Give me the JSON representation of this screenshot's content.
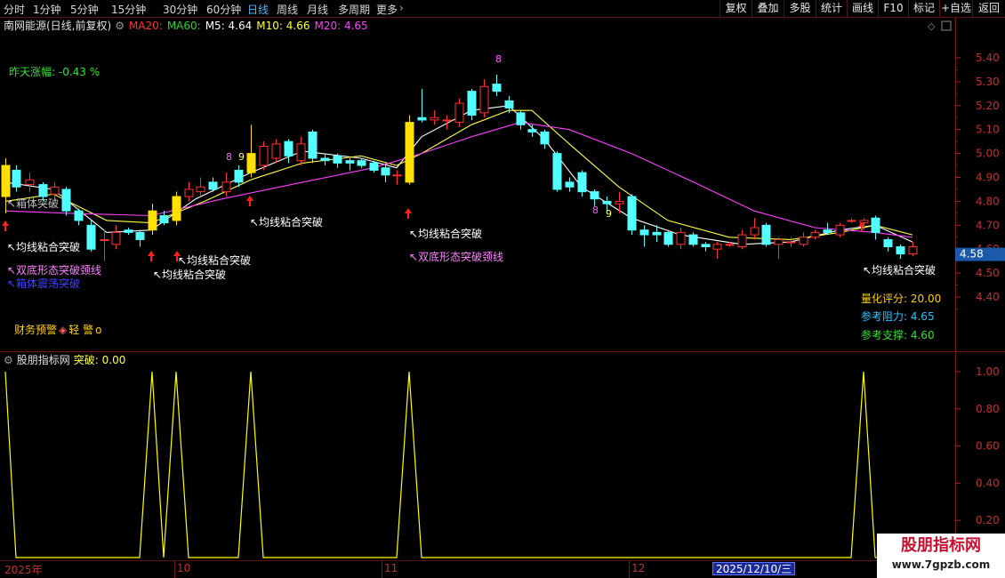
{
  "toolbar": {
    "left": [
      "分时",
      "1分钟",
      "5分钟",
      "15分钟",
      "30分钟",
      "60分钟",
      "日线",
      "周线",
      "月线",
      "多周期",
      "更多"
    ],
    "active": 6,
    "right": [
      "复权",
      "叠加",
      "多股",
      "统计",
      "画线",
      "F10",
      "标记",
      "+自选",
      "返回"
    ]
  },
  "header": {
    "stock": "南网能源(日线,前复权)",
    "ma": [
      {
        "label": "MA20:",
        "value": "",
        "color": "#ff3030"
      },
      {
        "label": "MA60:",
        "value": "",
        "color": "#30d030"
      },
      {
        "label": "M5:",
        "value": "4.64",
        "color": "#ffffff"
      },
      {
        "label": "M10:",
        "value": "4.66",
        "color": "#ffff40"
      },
      {
        "label": "M20:",
        "value": "4.65",
        "color": "#ff40ff"
      }
    ]
  },
  "left_panel": {
    "zhang_fu": "昨天涨幅: -0.43 %",
    "warning": "财务预警",
    "warning_level": "轻 警",
    "warning_mark": "o"
  },
  "right_panel": {
    "score": "量化评分: 20.00",
    "resistance": "参考阻力: 4.65",
    "support": "参考支撑: 4.60",
    "last_price": "4.58"
  },
  "colors": {
    "up": "#ff3232",
    "down": "#54ffff",
    "m5": "#ffffff",
    "m10": "#ffff40",
    "m20": "#ff40ff",
    "arrow": "#ff2020",
    "signal": "#ffff00"
  },
  "annotations": {
    "arrows": [
      6,
      170,
      199,
      281,
      459,
      969
    ],
    "labels": [
      {
        "text": "↖均线粘合突破",
        "x": 8,
        "y": 278,
        "color": "#ffffff"
      },
      {
        "text": "↖双底形态突破颈线",
        "x": 8,
        "y": 304,
        "color": "#ff80ff"
      },
      {
        "text": "↖箱体突破",
        "x": 8,
        "y": 229,
        "color": "#c0c0c0"
      },
      {
        "text": "↖箱体震荡突破",
        "x": 8,
        "y": 319,
        "color": "#4040ff"
      },
      {
        "text": "↖均线粘合突破",
        "x": 172,
        "y": 309,
        "color": "#ffffff"
      },
      {
        "text": "↖均线粘合突破",
        "x": 200,
        "y": 293,
        "color": "#ffffff"
      },
      {
        "text": "↖均线粘合突破",
        "x": 281,
        "y": 250,
        "color": "#ffffff"
      },
      {
        "text": "↖均线粘合突破",
        "x": 460,
        "y": 263,
        "color": "#ffffff"
      },
      {
        "text": "↖双底形态突破颈线",
        "x": 460,
        "y": 289,
        "color": "#ff80ff"
      },
      {
        "text": "↖均线粘合突破",
        "x": 970,
        "y": 304,
        "color": "#ffffff"
      }
    ],
    "counts": [
      {
        "text": "8",
        "x": 254,
        "y": 176,
        "color": "#ff60ff"
      },
      {
        "text": "9",
        "x": 268,
        "y": 176,
        "color": "#ffff60"
      },
      {
        "text": "8",
        "x": 557,
        "y": 66,
        "color": "#ff60ff"
      },
      {
        "text": "8",
        "x": 666,
        "y": 236,
        "color": "#ff60ff"
      },
      {
        "text": "9",
        "x": 681,
        "y": 240,
        "color": "#ffff60"
      }
    ]
  },
  "sub_panel": {
    "title": "股朋指标网",
    "signal_label": "突破:",
    "signal_value": "0.00",
    "peaks": [
      6,
      170,
      199,
      282,
      460,
      969
    ]
  },
  "xaxis": {
    "labels": [
      {
        "text": "2025年",
        "x": 5
      },
      {
        "text": "10",
        "x": 199
      },
      {
        "text": "11",
        "x": 432
      },
      {
        "text": "12",
        "x": 710
      }
    ],
    "cursor_date": "2025/12/10/三"
  },
  "watermark": {
    "title": "股朋指标网",
    "url": "www.7gpzb.com"
  },
  "chart_data": [
    {
      "type": "candlestick",
      "title": "南网能源(日线,前复权)",
      "y_axis_ticks": [
        4.4,
        4.5,
        4.6,
        4.7,
        4.8,
        4.9,
        5.0,
        5.1,
        5.2,
        5.3,
        5.4
      ],
      "ylim": [
        4.33,
        5.49
      ],
      "candles": [
        {
          "x": 6,
          "o": 4.82,
          "c": 4.95,
          "h": 4.98,
          "l": 4.75
        },
        {
          "x": 18,
          "o": 4.93,
          "c": 4.86,
          "h": 4.95,
          "l": 4.84
        },
        {
          "x": 33,
          "o": 4.87,
          "c": 4.89,
          "h": 4.92,
          "l": 4.84
        },
        {
          "x": 48,
          "o": 4.87,
          "c": 4.82,
          "h": 4.88,
          "l": 4.8
        },
        {
          "x": 61,
          "o": 4.83,
          "c": 4.86,
          "h": 4.88,
          "l": 4.8
        },
        {
          "x": 74,
          "o": 4.85,
          "c": 4.76,
          "h": 4.86,
          "l": 4.74
        },
        {
          "x": 88,
          "o": 4.76,
          "c": 4.72,
          "h": 4.77,
          "l": 4.7
        },
        {
          "x": 102,
          "o": 4.7,
          "c": 4.6,
          "h": 4.72,
          "l": 4.59
        },
        {
          "x": 117,
          "o": 4.64,
          "c": 4.64,
          "h": 4.68,
          "l": 4.55
        },
        {
          "x": 130,
          "o": 4.62,
          "c": 4.67,
          "h": 4.7,
          "l": 4.6
        },
        {
          "x": 144,
          "o": 4.68,
          "c": 4.67,
          "h": 4.69,
          "l": 4.66
        },
        {
          "x": 157,
          "o": 4.67,
          "c": 4.64,
          "h": 4.68,
          "l": 4.61
        },
        {
          "x": 171,
          "o": 4.68,
          "c": 4.76,
          "h": 4.79,
          "l": 4.66
        },
        {
          "x": 184,
          "o": 4.74,
          "c": 4.71,
          "h": 4.76,
          "l": 4.7
        },
        {
          "x": 198,
          "o": 4.72,
          "c": 4.82,
          "h": 4.84,
          "l": 4.7
        },
        {
          "x": 212,
          "o": 4.82,
          "c": 4.85,
          "h": 4.88,
          "l": 4.8
        },
        {
          "x": 225,
          "o": 4.84,
          "c": 4.86,
          "h": 4.9,
          "l": 4.82
        },
        {
          "x": 239,
          "o": 4.88,
          "c": 4.85,
          "h": 4.9,
          "l": 4.84
        },
        {
          "x": 254,
          "o": 4.84,
          "c": 4.88,
          "h": 4.92,
          "l": 4.82
        },
        {
          "x": 268,
          "o": 4.93,
          "c": 4.88,
          "h": 4.95,
          "l": 4.86
        },
        {
          "x": 282,
          "o": 4.92,
          "c": 5.0,
          "h": 5.12,
          "l": 4.9
        },
        {
          "x": 296,
          "o": 4.95,
          "c": 5.03,
          "h": 5.05,
          "l": 4.93
        },
        {
          "x": 310,
          "o": 4.98,
          "c": 5.04,
          "h": 5.06,
          "l": 4.96
        },
        {
          "x": 324,
          "o": 5.05,
          "c": 4.99,
          "h": 5.06,
          "l": 4.96
        },
        {
          "x": 338,
          "o": 4.97,
          "c": 5.04,
          "h": 5.07,
          "l": 4.95
        },
        {
          "x": 351,
          "o": 5.09,
          "c": 4.98,
          "h": 5.1,
          "l": 4.96
        },
        {
          "x": 365,
          "o": 4.98,
          "c": 4.97,
          "h": 5.0,
          "l": 4.95
        },
        {
          "x": 379,
          "o": 4.99,
          "c": 4.96,
          "h": 5.0,
          "l": 4.94
        },
        {
          "x": 393,
          "o": 4.97,
          "c": 4.96,
          "h": 4.98,
          "l": 4.93
        },
        {
          "x": 406,
          "o": 4.97,
          "c": 4.95,
          "h": 4.98,
          "l": 4.94
        },
        {
          "x": 420,
          "o": 4.96,
          "c": 4.93,
          "h": 4.97,
          "l": 4.92
        },
        {
          "x": 433,
          "o": 4.94,
          "c": 4.91,
          "h": 4.96,
          "l": 4.88
        },
        {
          "x": 446,
          "o": 4.91,
          "c": 4.91,
          "h": 4.93,
          "l": 4.87
        },
        {
          "x": 460,
          "o": 4.88,
          "c": 5.13,
          "h": 5.16,
          "l": 4.87
        },
        {
          "x": 474,
          "o": 5.15,
          "c": 5.14,
          "h": 5.27,
          "l": 5.13
        },
        {
          "x": 488,
          "o": 5.14,
          "c": 5.15,
          "h": 5.18,
          "l": 5.12
        },
        {
          "x": 502,
          "o": 5.14,
          "c": 5.14,
          "h": 5.16,
          "l": 5.1
        },
        {
          "x": 516,
          "o": 5.13,
          "c": 5.21,
          "h": 5.23,
          "l": 5.11
        },
        {
          "x": 530,
          "o": 5.26,
          "c": 5.16,
          "h": 5.27,
          "l": 5.14
        },
        {
          "x": 544,
          "o": 5.17,
          "c": 5.28,
          "h": 5.31,
          "l": 5.15
        },
        {
          "x": 558,
          "o": 5.29,
          "c": 5.26,
          "h": 5.33,
          "l": 5.24
        },
        {
          "x": 572,
          "o": 5.22,
          "c": 5.19,
          "h": 5.24,
          "l": 5.17
        },
        {
          "x": 585,
          "o": 5.17,
          "c": 5.12,
          "h": 5.18,
          "l": 5.1
        },
        {
          "x": 598,
          "o": 5.1,
          "c": 5.09,
          "h": 5.12,
          "l": 5.07
        },
        {
          "x": 612,
          "o": 5.09,
          "c": 5.04,
          "h": 5.1,
          "l": 5.02
        },
        {
          "x": 626,
          "o": 5.0,
          "c": 4.85,
          "h": 5.01,
          "l": 4.84
        },
        {
          "x": 640,
          "o": 4.88,
          "c": 4.86,
          "h": 4.9,
          "l": 4.84
        },
        {
          "x": 654,
          "o": 4.92,
          "c": 4.84,
          "h": 4.93,
          "l": 4.82
        },
        {
          "x": 668,
          "o": 4.84,
          "c": 4.81,
          "h": 4.85,
          "l": 4.78
        },
        {
          "x": 682,
          "o": 4.8,
          "c": 4.79,
          "h": 4.82,
          "l": 4.76
        },
        {
          "x": 696,
          "o": 4.79,
          "c": 4.8,
          "h": 4.84,
          "l": 4.75
        },
        {
          "x": 710,
          "o": 4.82,
          "c": 4.68,
          "h": 4.83,
          "l": 4.66
        },
        {
          "x": 724,
          "o": 4.68,
          "c": 4.66,
          "h": 4.7,
          "l": 4.61
        },
        {
          "x": 738,
          "o": 4.67,
          "c": 4.66,
          "h": 4.7,
          "l": 4.63
        },
        {
          "x": 751,
          "o": 4.67,
          "c": 4.62,
          "h": 4.68,
          "l": 4.61
        },
        {
          "x": 765,
          "o": 4.62,
          "c": 4.67,
          "h": 4.69,
          "l": 4.6
        },
        {
          "x": 779,
          "o": 4.66,
          "c": 4.62,
          "h": 4.67,
          "l": 4.61
        },
        {
          "x": 793,
          "o": 4.62,
          "c": 4.61,
          "h": 4.63,
          "l": 4.59
        },
        {
          "x": 806,
          "o": 4.6,
          "c": 4.62,
          "h": 4.63,
          "l": 4.56
        },
        {
          "x": 820,
          "o": 4.62,
          "c": 4.62,
          "h": 4.63,
          "l": 4.61
        },
        {
          "x": 834,
          "o": 4.61,
          "c": 4.66,
          "h": 4.68,
          "l": 4.6
        },
        {
          "x": 848,
          "o": 4.66,
          "c": 4.69,
          "h": 4.73,
          "l": 4.64
        },
        {
          "x": 861,
          "o": 4.7,
          "c": 4.62,
          "h": 4.71,
          "l": 4.61
        },
        {
          "x": 875,
          "o": 4.62,
          "c": 4.64,
          "h": 4.65,
          "l": 4.56
        },
        {
          "x": 889,
          "o": 4.63,
          "c": 4.63,
          "h": 4.65,
          "l": 4.61
        },
        {
          "x": 903,
          "o": 4.62,
          "c": 4.65,
          "h": 4.67,
          "l": 4.61
        },
        {
          "x": 916,
          "o": 4.65,
          "c": 4.67,
          "h": 4.68,
          "l": 4.64
        },
        {
          "x": 930,
          "o": 4.68,
          "c": 4.67,
          "h": 4.71,
          "l": 4.66
        },
        {
          "x": 944,
          "o": 4.66,
          "c": 4.7,
          "h": 4.71,
          "l": 4.65
        },
        {
          "x": 957,
          "o": 4.72,
          "c": 4.72,
          "h": 4.73,
          "l": 4.71
        },
        {
          "x": 971,
          "o": 4.71,
          "c": 4.72,
          "h": 4.73,
          "l": 4.68
        },
        {
          "x": 984,
          "o": 4.73,
          "c": 4.67,
          "h": 4.74,
          "l": 4.64
        },
        {
          "x": 998,
          "o": 4.64,
          "c": 4.61,
          "h": 4.65,
          "l": 4.59
        },
        {
          "x": 1012,
          "o": 4.61,
          "c": 4.58,
          "h": 4.62,
          "l": 4.56
        },
        {
          "x": 1026,
          "o": 4.58,
          "c": 4.61,
          "h": 4.63,
          "l": 4.57
        }
      ],
      "series": [
        {
          "name": "M5",
          "x": [
            6,
            60,
            120,
            170,
            220,
            282,
            340,
            406,
            446,
            474,
            530,
            572,
            612,
            654,
            710,
            765,
            834,
            889,
            944,
            984,
            1026
          ],
          "values": [
            4.88,
            4.85,
            4.67,
            4.68,
            4.81,
            4.92,
            5.01,
            4.98,
            4.94,
            5.07,
            5.18,
            5.2,
            5.06,
            4.86,
            4.73,
            4.66,
            4.62,
            4.63,
            4.68,
            4.7,
            4.63
          ]
        },
        {
          "name": "M10",
          "x": [
            6,
            60,
            120,
            170,
            230,
            282,
            340,
            406,
            446,
            474,
            530,
            572,
            598,
            640,
            696,
            751,
            820,
            889,
            944,
            984,
            1026
          ],
          "values": [
            4.8,
            4.83,
            4.72,
            4.71,
            4.8,
            4.89,
            4.96,
            4.99,
            4.95,
            5.0,
            5.12,
            5.18,
            5.18,
            5.04,
            4.86,
            4.72,
            4.65,
            4.64,
            4.67,
            4.7,
            4.66
          ]
        },
        {
          "name": "M20",
          "x": [
            6,
            80,
            170,
            250,
            340,
            420,
            474,
            530,
            585,
            640,
            710,
            780,
            848,
            916,
            984,
            1026
          ],
          "values": [
            4.76,
            4.75,
            4.74,
            4.81,
            4.88,
            4.94,
            5.0,
            5.07,
            5.13,
            5.1,
            5.0,
            4.88,
            4.76,
            4.69,
            4.67,
            4.65
          ]
        }
      ]
    },
    {
      "type": "line",
      "name": "突破",
      "y_axis_ticks": [
        0.2,
        0.4,
        0.6,
        0.8,
        1.0
      ],
      "ylim": [
        -0.04,
        1.06
      ],
      "x": [
        6,
        18,
        157,
        171,
        184,
        198,
        212,
        268,
        282,
        296,
        446,
        460,
        474,
        957,
        971,
        984
      ],
      "values": [
        1,
        0,
        0,
        1,
        0,
        1,
        0,
        0,
        1,
        0,
        0,
        1,
        0,
        0,
        1,
        0
      ]
    }
  ]
}
